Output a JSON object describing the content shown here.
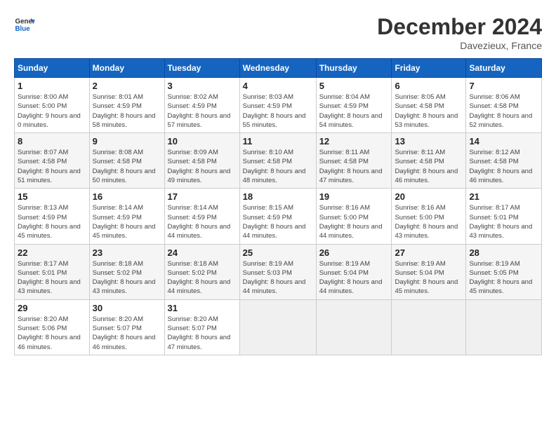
{
  "header": {
    "logo_line1": "General",
    "logo_line2": "Blue",
    "month_title": "December 2024",
    "location": "Davezieux, France"
  },
  "weekdays": [
    "Sunday",
    "Monday",
    "Tuesday",
    "Wednesday",
    "Thursday",
    "Friday",
    "Saturday"
  ],
  "weeks": [
    [
      {
        "day": "1",
        "sunrise": "8:00 AM",
        "sunset": "5:00 PM",
        "daylight": "9 hours and 0 minutes."
      },
      {
        "day": "2",
        "sunrise": "8:01 AM",
        "sunset": "4:59 PM",
        "daylight": "8 hours and 58 minutes."
      },
      {
        "day": "3",
        "sunrise": "8:02 AM",
        "sunset": "4:59 PM",
        "daylight": "8 hours and 57 minutes."
      },
      {
        "day": "4",
        "sunrise": "8:03 AM",
        "sunset": "4:59 PM",
        "daylight": "8 hours and 55 minutes."
      },
      {
        "day": "5",
        "sunrise": "8:04 AM",
        "sunset": "4:59 PM",
        "daylight": "8 hours and 54 minutes."
      },
      {
        "day": "6",
        "sunrise": "8:05 AM",
        "sunset": "4:58 PM",
        "daylight": "8 hours and 53 minutes."
      },
      {
        "day": "7",
        "sunrise": "8:06 AM",
        "sunset": "4:58 PM",
        "daylight": "8 hours and 52 minutes."
      }
    ],
    [
      {
        "day": "8",
        "sunrise": "8:07 AM",
        "sunset": "4:58 PM",
        "daylight": "8 hours and 51 minutes."
      },
      {
        "day": "9",
        "sunrise": "8:08 AM",
        "sunset": "4:58 PM",
        "daylight": "8 hours and 50 minutes."
      },
      {
        "day": "10",
        "sunrise": "8:09 AM",
        "sunset": "4:58 PM",
        "daylight": "8 hours and 49 minutes."
      },
      {
        "day": "11",
        "sunrise": "8:10 AM",
        "sunset": "4:58 PM",
        "daylight": "8 hours and 48 minutes."
      },
      {
        "day": "12",
        "sunrise": "8:11 AM",
        "sunset": "4:58 PM",
        "daylight": "8 hours and 47 minutes."
      },
      {
        "day": "13",
        "sunrise": "8:11 AM",
        "sunset": "4:58 PM",
        "daylight": "8 hours and 46 minutes."
      },
      {
        "day": "14",
        "sunrise": "8:12 AM",
        "sunset": "4:58 PM",
        "daylight": "8 hours and 46 minutes."
      }
    ],
    [
      {
        "day": "15",
        "sunrise": "8:13 AM",
        "sunset": "4:59 PM",
        "daylight": "8 hours and 45 minutes."
      },
      {
        "day": "16",
        "sunrise": "8:14 AM",
        "sunset": "4:59 PM",
        "daylight": "8 hours and 45 minutes."
      },
      {
        "day": "17",
        "sunrise": "8:14 AM",
        "sunset": "4:59 PM",
        "daylight": "8 hours and 44 minutes."
      },
      {
        "day": "18",
        "sunrise": "8:15 AM",
        "sunset": "4:59 PM",
        "daylight": "8 hours and 44 minutes."
      },
      {
        "day": "19",
        "sunrise": "8:16 AM",
        "sunset": "5:00 PM",
        "daylight": "8 hours and 44 minutes."
      },
      {
        "day": "20",
        "sunrise": "8:16 AM",
        "sunset": "5:00 PM",
        "daylight": "8 hours and 43 minutes."
      },
      {
        "day": "21",
        "sunrise": "8:17 AM",
        "sunset": "5:01 PM",
        "daylight": "8 hours and 43 minutes."
      }
    ],
    [
      {
        "day": "22",
        "sunrise": "8:17 AM",
        "sunset": "5:01 PM",
        "daylight": "8 hours and 43 minutes."
      },
      {
        "day": "23",
        "sunrise": "8:18 AM",
        "sunset": "5:02 PM",
        "daylight": "8 hours and 43 minutes."
      },
      {
        "day": "24",
        "sunrise": "8:18 AM",
        "sunset": "5:02 PM",
        "daylight": "8 hours and 44 minutes."
      },
      {
        "day": "25",
        "sunrise": "8:19 AM",
        "sunset": "5:03 PM",
        "daylight": "8 hours and 44 minutes."
      },
      {
        "day": "26",
        "sunrise": "8:19 AM",
        "sunset": "5:04 PM",
        "daylight": "8 hours and 44 minutes."
      },
      {
        "day": "27",
        "sunrise": "8:19 AM",
        "sunset": "5:04 PM",
        "daylight": "8 hours and 45 minutes."
      },
      {
        "day": "28",
        "sunrise": "8:19 AM",
        "sunset": "5:05 PM",
        "daylight": "8 hours and 45 minutes."
      }
    ],
    [
      {
        "day": "29",
        "sunrise": "8:20 AM",
        "sunset": "5:06 PM",
        "daylight": "8 hours and 46 minutes."
      },
      {
        "day": "30",
        "sunrise": "8:20 AM",
        "sunset": "5:07 PM",
        "daylight": "8 hours and 46 minutes."
      },
      {
        "day": "31",
        "sunrise": "8:20 AM",
        "sunset": "5:07 PM",
        "daylight": "8 hours and 47 minutes."
      },
      null,
      null,
      null,
      null
    ]
  ],
  "labels": {
    "sunrise": "Sunrise:",
    "sunset": "Sunset:",
    "daylight": "Daylight:"
  }
}
